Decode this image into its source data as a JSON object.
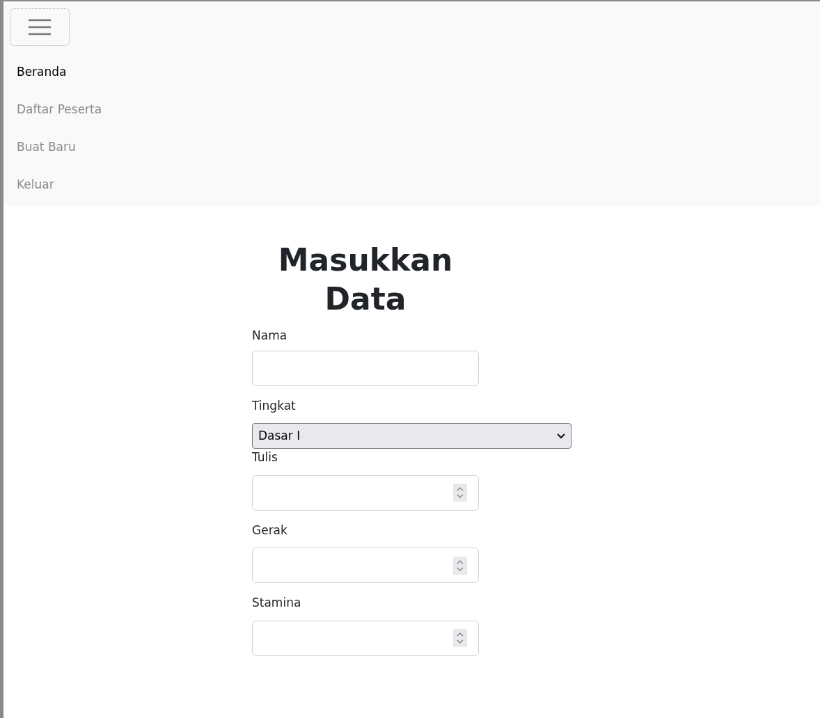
{
  "nav": {
    "items": [
      {
        "label": "Beranda",
        "selected": true
      },
      {
        "label": "Daftar Peserta",
        "selected": false
      },
      {
        "label": "Buat Baru",
        "selected": false
      },
      {
        "label": "Keluar",
        "selected": false
      }
    ]
  },
  "form": {
    "title": "Masukkan Data",
    "fields": [
      {
        "label": "Nama",
        "kind": "text"
      },
      {
        "label": "Tingkat",
        "kind": "select",
        "value": "Dasar I"
      },
      {
        "label": "Tulis",
        "kind": "number"
      },
      {
        "label": "Gerak",
        "kind": "number"
      },
      {
        "label": "Stamina",
        "kind": "number"
      }
    ]
  }
}
